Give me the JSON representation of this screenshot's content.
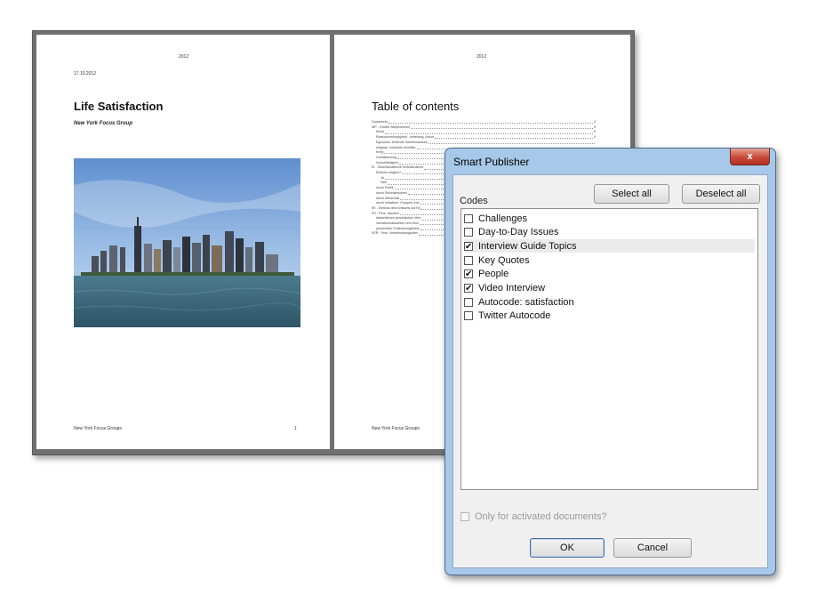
{
  "document": {
    "left_page": {
      "year": "2012",
      "date": "17.10.2012",
      "title": "Life Satisfaction",
      "subtitle": "New York Focus Group",
      "footer": "New York Focus Groups",
      "page_number": "1"
    },
    "right_page": {
      "year": "2012",
      "title": "Table of contents",
      "footer": "New York Focus Groups",
      "toc": [
        {
          "text": "Documents",
          "page": "4",
          "level": 0
        },
        {
          "text": "WP - Größte Weltprobleme",
          "page": "5",
          "level": 0
        },
        {
          "text": "Klima",
          "page": "8",
          "level": 1
        },
        {
          "text": "Ressourcenknappheit, -verteilung, Armut",
          "page": "9",
          "level": 1
        },
        {
          "text": "Egoismus, fehlende Gemeinsamkeit",
          "page": "",
          "level": 1
        },
        {
          "text": "religiöse, kulturelle Konflikte",
          "page": "",
          "level": 1
        },
        {
          "text": "Krieg",
          "page": "",
          "level": 1
        },
        {
          "text": "Globalisierung",
          "page": "",
          "level": 1
        },
        {
          "text": "Schnelllebigkeit",
          "page": "",
          "level": 1
        },
        {
          "text": "EI - Gesellschaftliche Einflussnahme",
          "page": "",
          "level": 0
        },
        {
          "text": "Einfluss möglich?",
          "page": "",
          "level": 1
        },
        {
          "text": "Ja",
          "page": "",
          "level": 2
        },
        {
          "text": "Nein",
          "page": "",
          "level": 2
        },
        {
          "text": "durch Politik",
          "page": "",
          "level": 1
        },
        {
          "text": "durch Einzelpersonen",
          "page": "",
          "level": 1
        },
        {
          "text": "durch Wirtschaft",
          "page": "",
          "level": 1
        },
        {
          "text": "durch Initiativen, Gruppen (nat",
          "page": "",
          "level": 1
        },
        {
          "text": "KK - Einfluss des Konsums auf Kli",
          "page": "",
          "level": 0
        },
        {
          "text": "PH - Pers. Handeln",
          "page": "",
          "level": 0
        },
        {
          "text": "tatsächliches persönliches Verh",
          "page": "",
          "level": 1
        },
        {
          "text": "Verhaltensabsichten und Wün",
          "page": "",
          "level": 1
        },
        {
          "text": "persönliche Einflussmöglichkei",
          "page": "",
          "level": 1
        },
        {
          "text": "VER - Pers. Verantwortungsüber",
          "page": "",
          "level": 0
        }
      ]
    }
  },
  "dialog": {
    "title": "Smart Publisher",
    "close_glyph": "x",
    "codes_label": "Codes",
    "select_all": "Select all",
    "deselect_all": "Deselect all",
    "codes": [
      {
        "label": "Challenges",
        "checked": false
      },
      {
        "label": "Day-to-Day Issues",
        "checked": false
      },
      {
        "label": "Interview Guide Topics",
        "checked": true
      },
      {
        "label": "Key Quotes",
        "checked": false
      },
      {
        "label": "People",
        "checked": true
      },
      {
        "label": "Video Interview",
        "checked": true
      },
      {
        "label": "Autocode: satisfaction",
        "checked": false
      },
      {
        "label": "Twitter Autocode",
        "checked": false
      }
    ],
    "only_activated": "Only for activated documents?",
    "ok": "OK",
    "cancel": "Cancel",
    "check_glyph": "✔"
  }
}
